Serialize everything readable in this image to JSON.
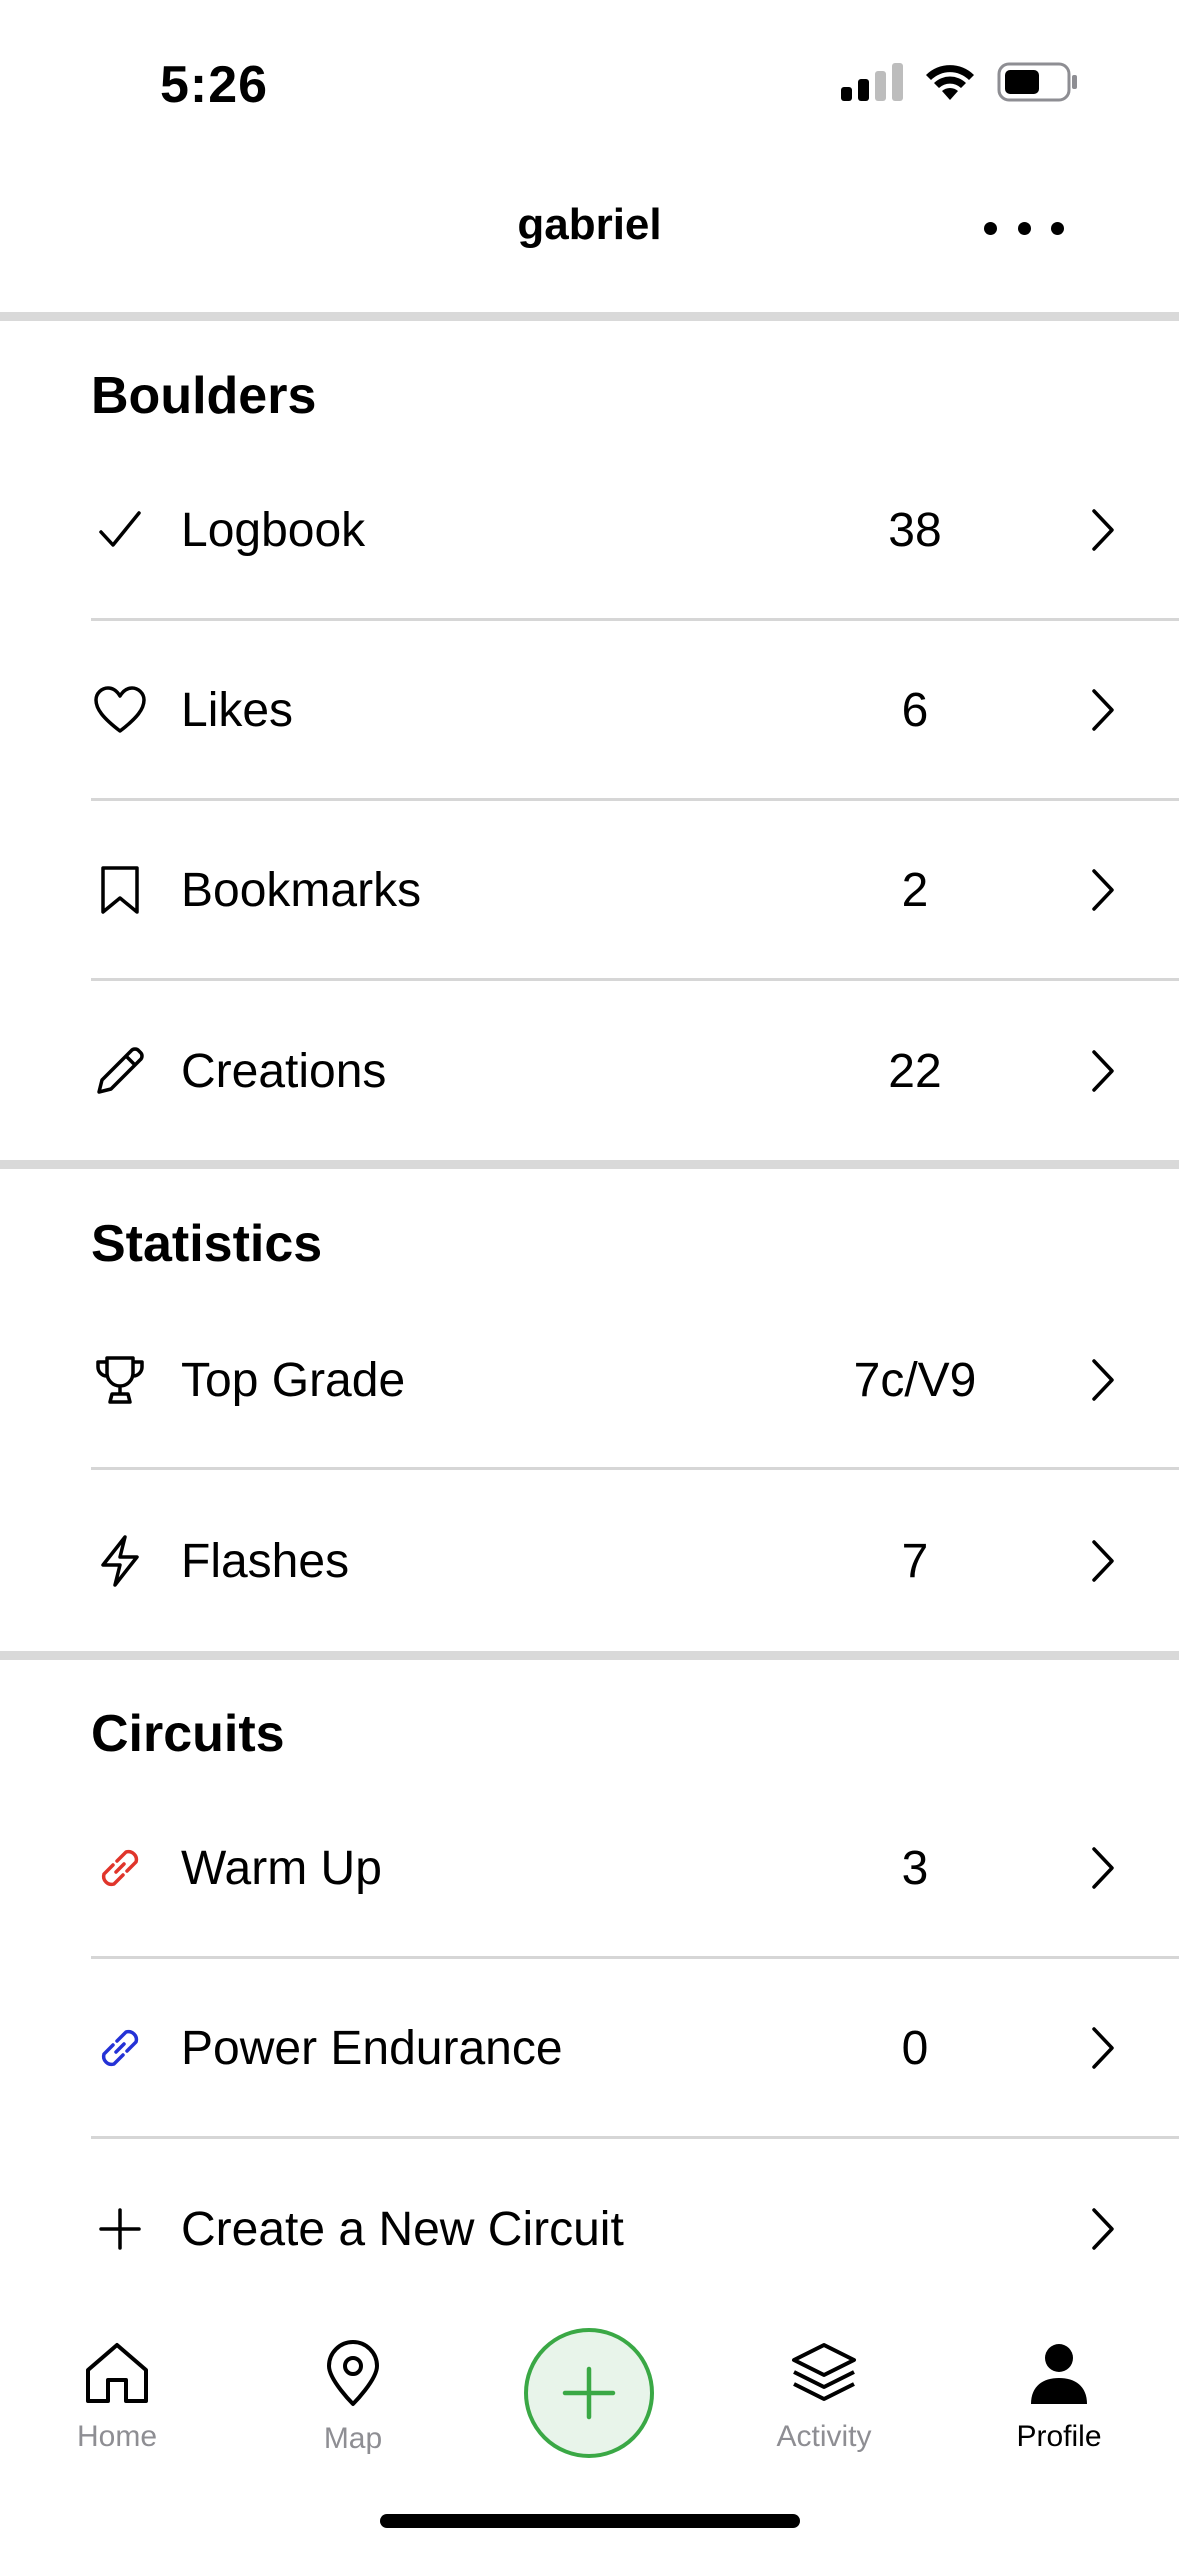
{
  "status": {
    "time": "5:26"
  },
  "header": {
    "title": "gabriel"
  },
  "sections": {
    "boulders": {
      "title": "Boulders",
      "items": [
        {
          "label": "Logbook",
          "value": "38",
          "icon": "check-icon"
        },
        {
          "label": "Likes",
          "value": "6",
          "icon": "heart-icon"
        },
        {
          "label": "Bookmarks",
          "value": "2",
          "icon": "bookmark-icon"
        },
        {
          "label": "Creations",
          "value": "22",
          "icon": "pencil-icon"
        }
      ]
    },
    "statistics": {
      "title": "Statistics",
      "items": [
        {
          "label": "Top Grade",
          "value": "7c/V9",
          "icon": "trophy-icon"
        },
        {
          "label": "Flashes",
          "value": "7",
          "icon": "lightning-icon"
        }
      ]
    },
    "circuits": {
      "title": "Circuits",
      "items": [
        {
          "label": "Warm Up",
          "value": "3",
          "icon": "link-icon",
          "color": "#e0352b"
        },
        {
          "label": "Power Endurance",
          "value": "0",
          "icon": "link-icon",
          "color": "#2432d6"
        },
        {
          "label": "Create a New Circuit",
          "value": "",
          "icon": "plus-icon"
        }
      ]
    }
  },
  "tabbar": {
    "home": "Home",
    "map": "Map",
    "activity": "Activity",
    "profile": "Profile",
    "accent": "#3aa845"
  }
}
